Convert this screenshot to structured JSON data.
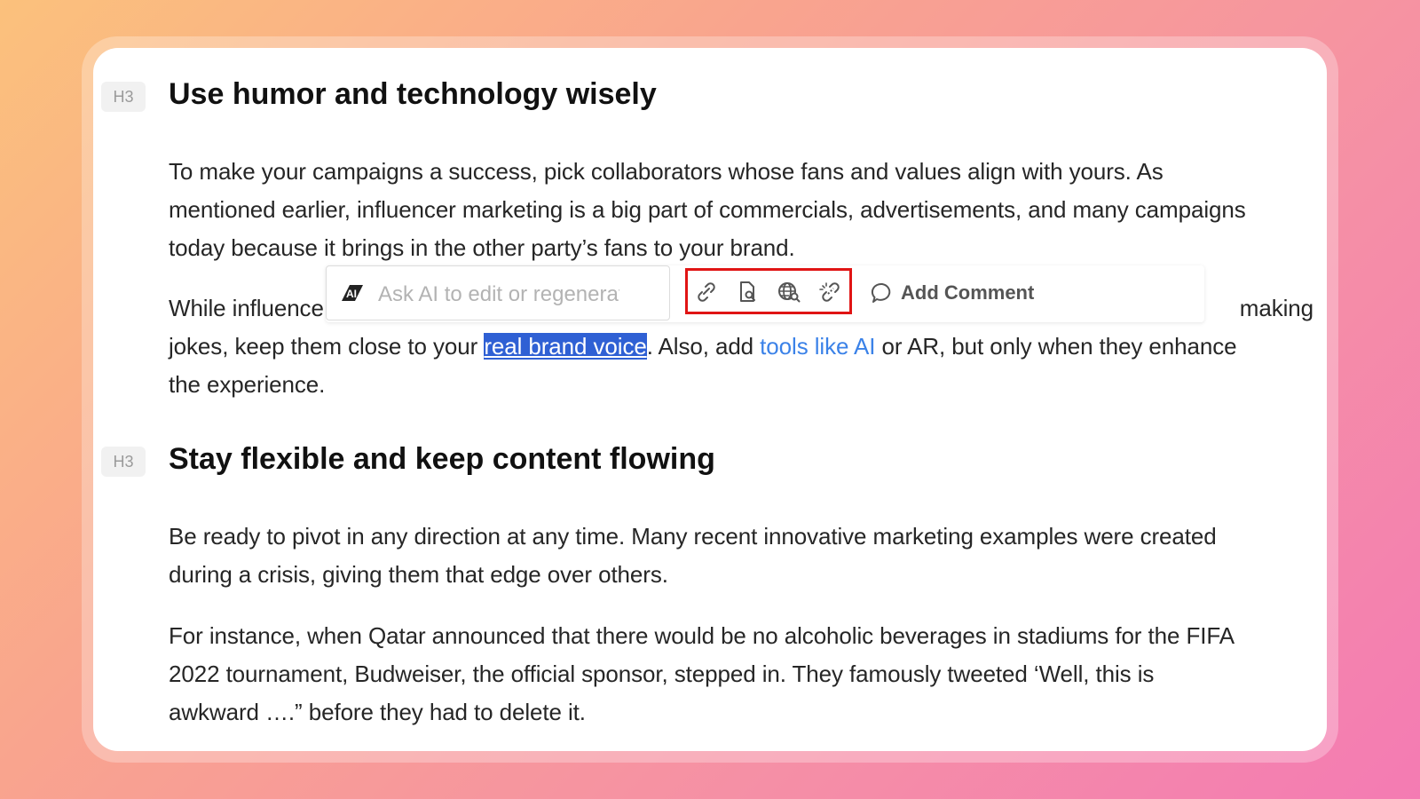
{
  "sections": [
    {
      "tag": "H3",
      "heading": "Use humor and technology wisely",
      "p1": {
        "lines": [
          "To make your campaigns a success, pick collaborators whose fans and values align with yours. As",
          "mentioned earlier, influencer marketing is a big part of commercials, advertisements, and many campaigns",
          "today because it brings in the other party’s fans to your brand."
        ]
      },
      "p2": {
        "line1_start": "While influence",
        "line1_end": "making",
        "line2_pre": "jokes, keep them close to your ",
        "selected_link": "real brand voice",
        "line2_mid": ". Also, add ",
        "link2": "tools like AI",
        "line2_post": " or AR, but only when they enhance",
        "line3": "the experience."
      }
    },
    {
      "tag": "H3",
      "heading": "Stay flexible and keep content flowing",
      "p1": {
        "lines": [
          "Be ready to pivot in any direction at any time. Many recent innovative marketing examples were created",
          "during a crisis, giving them that edge over others."
        ]
      },
      "p2": {
        "lines": [
          "For instance, when Qatar announced that there would be no alcoholic beverages in stadiums for the FIFA",
          "2022 tournament, Budweiser, the official sponsor, stepped in. They famously tweeted ‘Well, this is",
          "awkward ….” before they had to delete it."
        ]
      }
    }
  ],
  "toolbar": {
    "ai_placeholder": "Ask AI to edit or regenerate",
    "ai_icon": "ai-logo-icon",
    "icons": [
      "link-icon",
      "document-search-icon",
      "globe-search-icon",
      "unlink-icon"
    ],
    "comment_icon": "comment-bubble-icon",
    "comment_label": "Add Comment"
  },
  "colors": {
    "selection": "#2f60d4",
    "link": "#3b82e8",
    "highlight_border": "#e01414"
  }
}
